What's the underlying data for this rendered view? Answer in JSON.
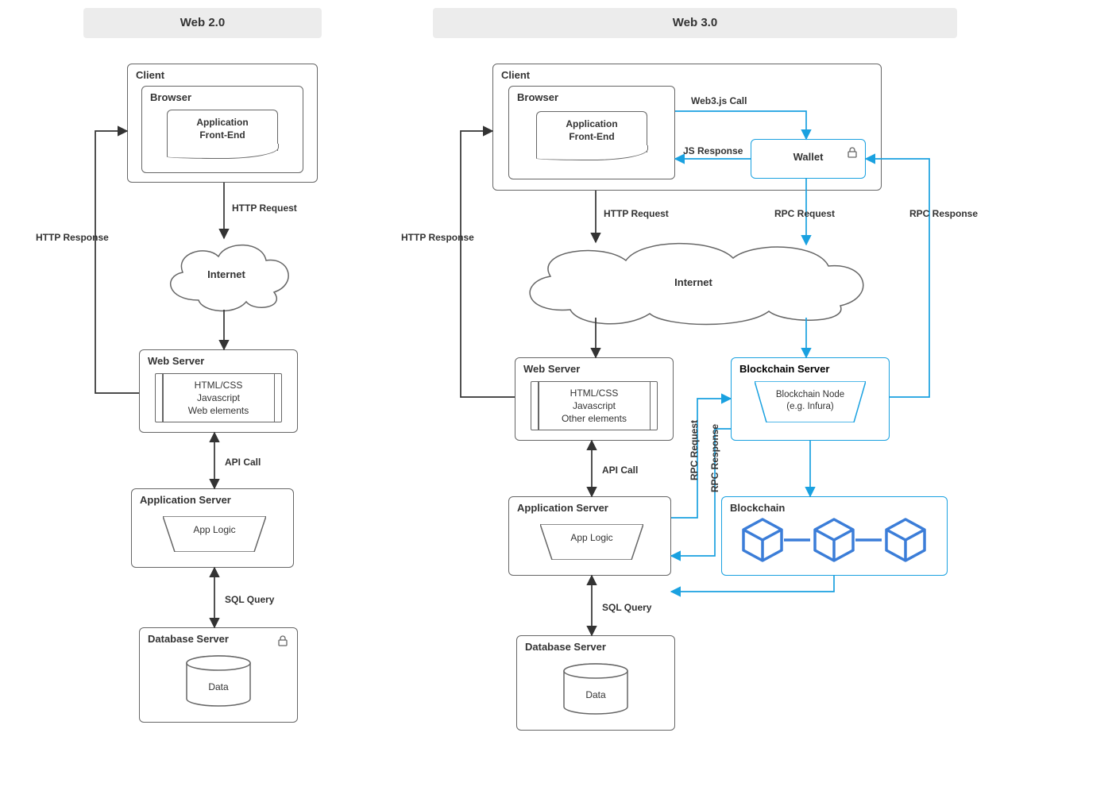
{
  "headers": {
    "web2": "Web 2.0",
    "web3": "Web 3.0"
  },
  "web2": {
    "client": "Client",
    "browser": "Browser",
    "frontend_l1": "Application",
    "frontend_l2": "Front-End",
    "internet": "Internet",
    "webserver": "Web Server",
    "webserver_l1": "HTML/CSS",
    "webserver_l2": "Javascript",
    "webserver_l3": "Web elements",
    "appserver": "Application Server",
    "applogic": "App Logic",
    "dbserver": "Database Server",
    "data": "Data",
    "edge_http_req": "HTTP Request",
    "edge_http_res": "HTTP Response",
    "edge_api": "API Call",
    "edge_sql": "SQL Query"
  },
  "web3": {
    "client": "Client",
    "browser": "Browser",
    "frontend_l1": "Application",
    "frontend_l2": "Front-End",
    "wallet": "Wallet",
    "internet": "Internet",
    "webserver": "Web Server",
    "webserver_l1": "HTML/CSS",
    "webserver_l2": "Javascript",
    "webserver_l3": "Other elements",
    "appserver": "Application Server",
    "applogic": "App Logic",
    "dbserver": "Database Server",
    "data": "Data",
    "bcserver": "Blockchain Server",
    "bcnode_l1": "Blockchain Node",
    "bcnode_l2": "(e.g. Infura)",
    "bc": "Blockchain",
    "edge_http_req": "HTTP Request",
    "edge_http_res": "HTTP Response",
    "edge_api": "API Call",
    "edge_sql": "SQL Query",
    "edge_web3js": "Web3.js Call",
    "edge_jsres": "JS Response",
    "edge_rpc_req": "RPC Request",
    "edge_rpc_res": "RPC Response",
    "edge_rpc_req2": "RPC Request",
    "edge_rpc_res2": "RPC Response"
  },
  "colors": {
    "gray": "#666666",
    "blue": "#1aa1e0",
    "blue2": "#3b7dd8",
    "band": "#ececec"
  }
}
